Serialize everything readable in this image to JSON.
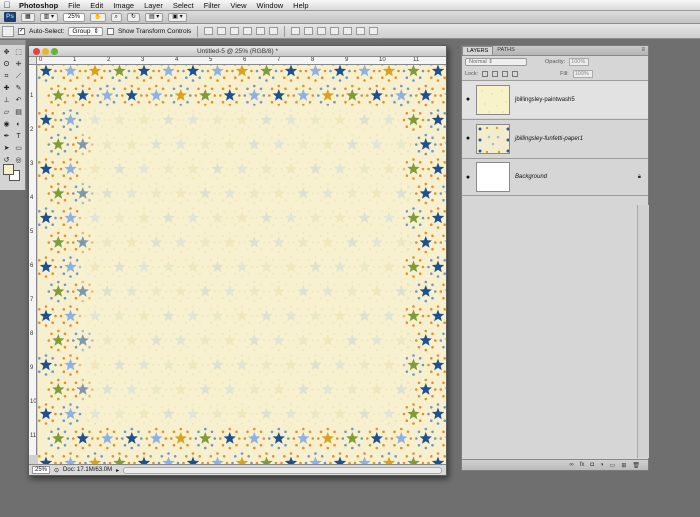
{
  "menubar": {
    "app_name": "Photoshop",
    "items": [
      "File",
      "Edit",
      "Image",
      "Layer",
      "Select",
      "Filter",
      "View",
      "Window",
      "Help"
    ]
  },
  "appbar": {
    "logo": "Ps",
    "zoom": "25%"
  },
  "options": {
    "auto_select_label": "Auto-Select:",
    "auto_select_value": "Group",
    "transform_label": "Show Transform Controls"
  },
  "document": {
    "title": "Untitled-5 @ 25% (RGB/8) *",
    "zoom": "25%",
    "doc_size": "Doc: 17.1M/63.0M",
    "ruler_marks": [
      "0",
      "1",
      "2",
      "3",
      "4",
      "5",
      "6",
      "7",
      "8",
      "9",
      "10",
      "11"
    ],
    "ruler_v_marks": [
      "1",
      "2",
      "3",
      "4",
      "5",
      "6",
      "7",
      "8",
      "9",
      "10",
      "11"
    ]
  },
  "layers_panel": {
    "tabs": [
      "LAYERS",
      "PATHS"
    ],
    "blend_mode": "Normal",
    "opacity_label": "Opacity:",
    "opacity_value": "100%",
    "lock_label": "Lock:",
    "fill_label": "Fill:",
    "fill_value": "100%",
    "layers": [
      {
        "name": "jbillingsley-paintwash5",
        "visible": true
      },
      {
        "name": "jbillingsley-funfetti-paper1",
        "visible": true
      },
      {
        "name": "Background",
        "visible": true,
        "locked": true
      }
    ]
  },
  "colors": {
    "paper": "#f6f0cf",
    "star_navy": "#1f4f8c",
    "star_gold": "#d9a21c",
    "star_green": "#7f9b3a",
    "star_blue": "#8fb1df",
    "dot_orange": "#e08a1e",
    "dot_blue": "#6c8fbf"
  }
}
